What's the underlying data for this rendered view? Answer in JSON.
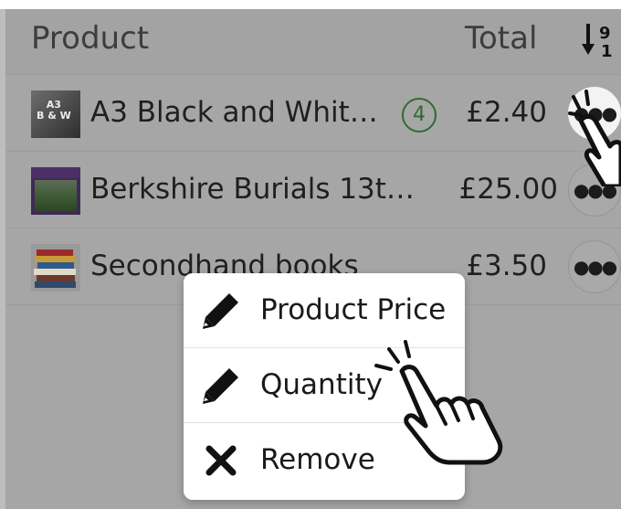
{
  "table": {
    "header": {
      "product_label": "Product",
      "total_label": "Total"
    },
    "rows": [
      {
        "name": "A3 Black and Whit…",
        "quantity": "4",
        "price": "£2.40",
        "thumb_text_line1": "A3",
        "thumb_text_line2": "B & W",
        "more_label": "●●●"
      },
      {
        "name": "Berkshire Burials 13t…",
        "price": "£25.00",
        "more_label": "●●●"
      },
      {
        "name": "Secondhand books",
        "price": "£3.50",
        "more_label": "●●●"
      }
    ]
  },
  "menu": {
    "items": [
      {
        "label": "Product Price",
        "icon": "pencil-icon"
      },
      {
        "label": "Quantity",
        "icon": "pencil-icon"
      },
      {
        "label": "Remove",
        "icon": "close-icon"
      }
    ]
  },
  "colors": {
    "background": "#a6a6a6",
    "qty_badge": "#2f6b2f",
    "menu_background": "#ffffff",
    "text": "#1f1f1f"
  }
}
